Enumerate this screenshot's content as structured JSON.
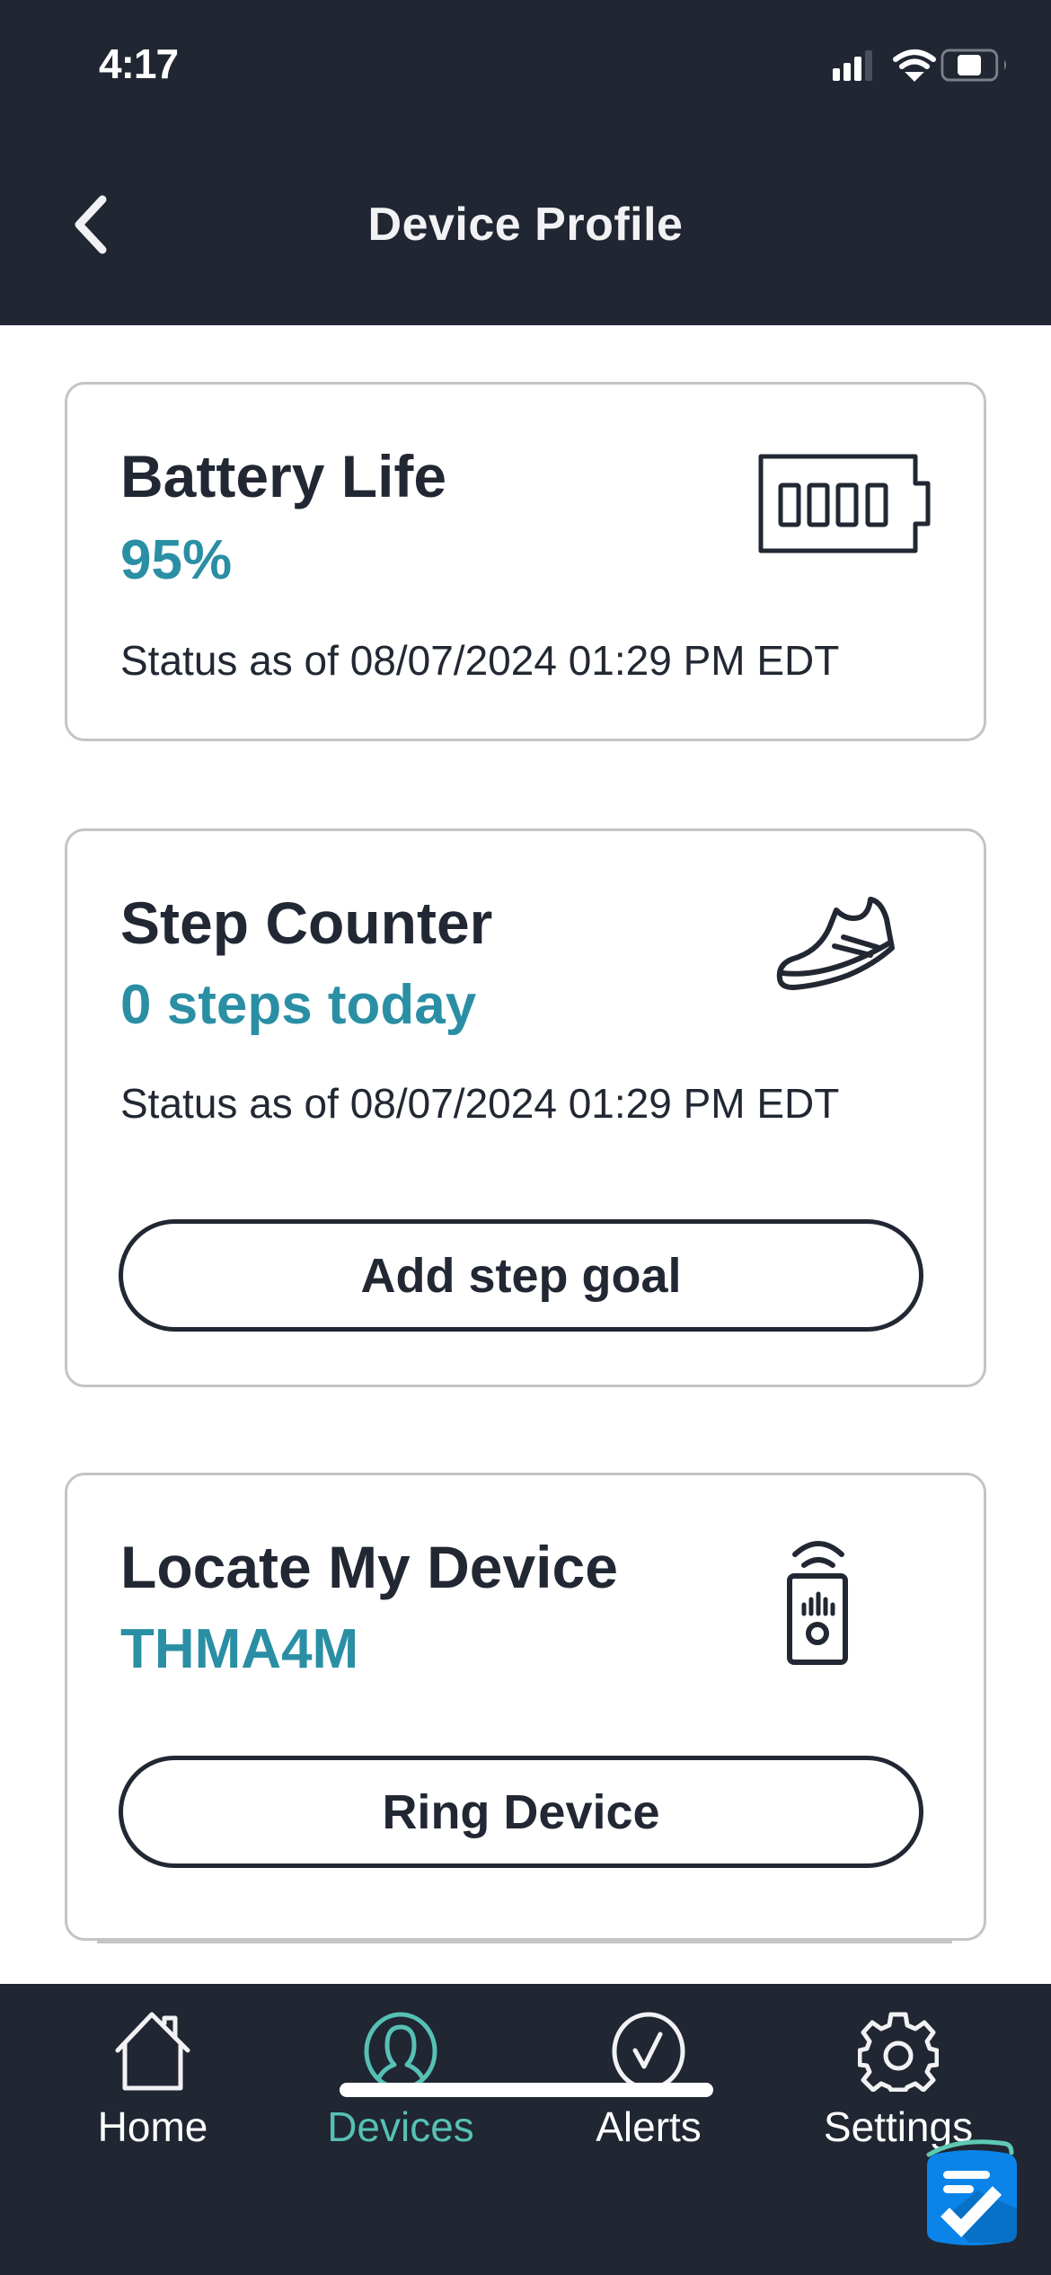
{
  "status_bar": {
    "time": "4:17",
    "signal_bars": 3,
    "signal_bars_total": 4,
    "battery_level_fraction": 0.45
  },
  "header": {
    "title": "Device Profile",
    "back_icon": "chevron-left-icon"
  },
  "cards": {
    "battery": {
      "title": "Battery Life",
      "value": "95%",
      "status": "Status as of 08/07/2024 01:29 PM EDT",
      "icon": "battery-full-icon"
    },
    "steps": {
      "title": "Step Counter",
      "value": "0 steps today",
      "status": "Status as of 08/07/2024 01:29 PM EDT",
      "icon": "shoe-icon",
      "button_label": "Add step goal"
    },
    "locate": {
      "title": "Locate My Device",
      "value": "THMA4M",
      "icon": "device-signal-icon",
      "button_label": "Ring Device"
    }
  },
  "tabbar": {
    "items": [
      {
        "label": "Home",
        "icon": "home-icon",
        "active": false
      },
      {
        "label": "Devices",
        "icon": "person-circle-icon",
        "active": true
      },
      {
        "label": "Alerts",
        "icon": "check-circle-icon",
        "active": false
      },
      {
        "label": "Settings",
        "icon": "gear-icon",
        "active": false
      }
    ]
  },
  "colors": {
    "header_bg": "#202632",
    "accent_teal": "#2a8fa5",
    "tab_active": "#56c0b4",
    "text_dark": "#222833",
    "card_border": "#c4c4c4",
    "feedback_blue": "#0a84e8"
  }
}
